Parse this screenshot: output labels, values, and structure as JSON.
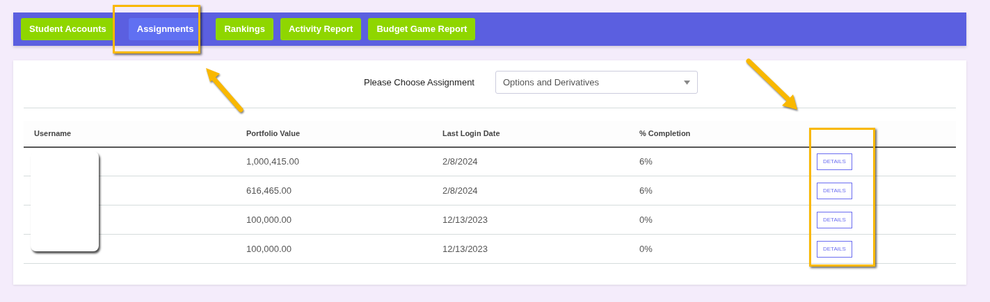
{
  "nav": [
    {
      "label": "Student Accounts",
      "selected": false
    },
    {
      "label": "Assignments",
      "selected": true
    },
    {
      "label": "Rankings",
      "selected": false
    },
    {
      "label": "Activity Report",
      "selected": false
    },
    {
      "label": "Budget Game Report",
      "selected": false
    }
  ],
  "assignment_picker": {
    "label": "Please Choose Assignment",
    "value": "Options and Derivatives"
  },
  "table": {
    "columns": [
      "Username",
      "Portfolio Value",
      "Last Login Date",
      "% Completion"
    ],
    "rows": [
      {
        "portfolio_value": "1,000,415.00",
        "last_login_date": "2/8/2024",
        "completion": "6%",
        "action": "DETAILS"
      },
      {
        "portfolio_value": "616,465.00",
        "last_login_date": "2/8/2024",
        "completion": "6%",
        "action": "DETAILS"
      },
      {
        "portfolio_value": "100,000.00",
        "last_login_date": "12/13/2023",
        "completion": "0%",
        "action": "DETAILS"
      },
      {
        "portfolio_value": "100,000.00",
        "last_login_date": "12/13/2023",
        "completion": "0%",
        "action": "DETAILS"
      }
    ]
  }
}
